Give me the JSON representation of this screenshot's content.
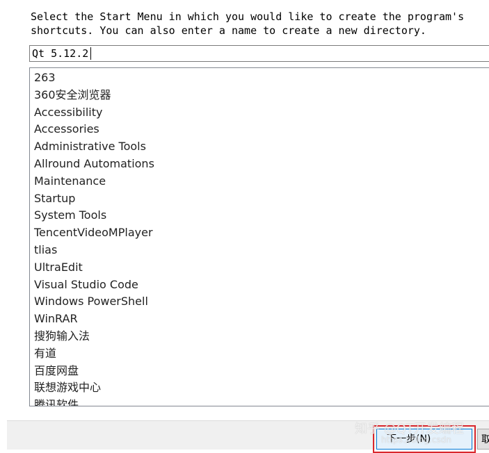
{
  "instructions": {
    "text": "Select the Start Menu in which you would like to create the program's\nshortcuts. You can also enter a name to create a new directory."
  },
  "directory_input": {
    "value": "Qt 5.12.2"
  },
  "start_menu_folders": [
    "263",
    "360安全浏览器",
    "Accessibility",
    "Accessories",
    "Administrative Tools",
    "Allround Automations",
    "Maintenance",
    "Startup",
    "System Tools",
    "TencentVideoMPlayer",
    "tlias",
    "UltraEdit",
    "Visual Studio Code",
    "Windows PowerShell",
    "WinRAR",
    "搜狗输入法",
    "有道",
    "百度网盘",
    "联想游戏中心",
    "腾讯软件"
  ],
  "buttons": {
    "next_label": "下一步(N)",
    "cancel_label": "取"
  },
  "watermark": {
    "main": "知乎 @QT开发编程",
    "url": "https://blog.csdn"
  },
  "colors": {
    "highlight_border": "#d9262c",
    "focus_border": "#0078d7",
    "button_bar_bg": "#f0f0f0"
  }
}
